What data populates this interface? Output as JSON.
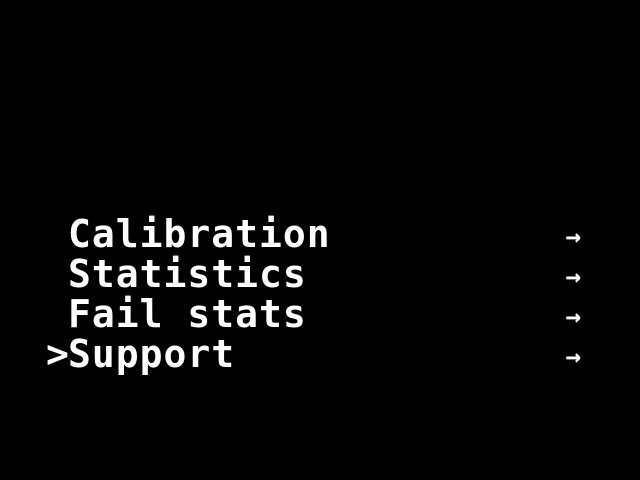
{
  "menu": {
    "cursor_glyph": ">",
    "selected_index": 3,
    "items": [
      {
        "label": "Calibration",
        "arrow": "→"
      },
      {
        "label": "Statistics",
        "arrow": "→"
      },
      {
        "label": "Fail stats",
        "arrow": "→"
      },
      {
        "label": "Support",
        "arrow": "→"
      }
    ]
  },
  "colors": {
    "background": "#000000",
    "text": "#ffffff"
  }
}
